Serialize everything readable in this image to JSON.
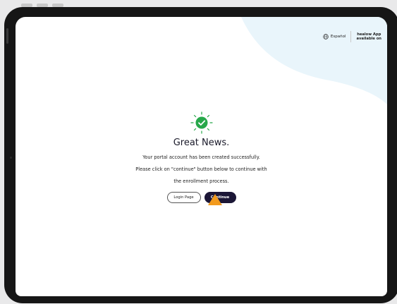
{
  "topbar": {
    "language_label": "Español",
    "app_promo_line1": "healow App",
    "app_promo_line2": "available on"
  },
  "main": {
    "title": "Great News.",
    "line1": "Your portal account has been created successfully.",
    "line2": "Please click on \"continue\" button below to continue with",
    "line3": "the enrollment process."
  },
  "buttons": {
    "login_label": "Login Page",
    "continue_label": "Continue"
  },
  "colors": {
    "accent_dark": "#1b1636",
    "success_green": "#27a84a",
    "highlight_orange": "#f29a1d",
    "blob_light_blue": "#e9f5fb"
  }
}
